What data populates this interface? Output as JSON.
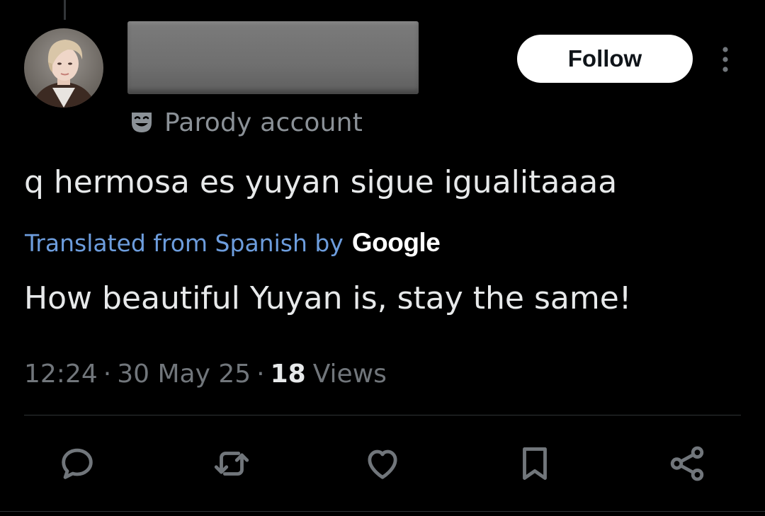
{
  "tweet": {
    "author": {
      "avatar_icon": "profile-photo",
      "label": "Parody account",
      "label_icon": "theater-mask-icon"
    },
    "follow_label": "Follow",
    "more_icon": "more-vertical-icon",
    "text": "q hermosa es yuyan sigue igualitaaaa",
    "translation": {
      "source_label": "Translated from Spanish by",
      "provider": "Google",
      "text": "How beautiful Yuyan is, stay the same!"
    },
    "meta": {
      "time": "12:24",
      "date": "30 May 25",
      "views_count": "18",
      "views_label": "Views",
      "separator": "·"
    },
    "actions": [
      {
        "name": "reply",
        "icon": "reply-icon"
      },
      {
        "name": "repost",
        "icon": "repost-icon"
      },
      {
        "name": "like",
        "icon": "heart-icon"
      },
      {
        "name": "bookmark",
        "icon": "bookmark-icon"
      },
      {
        "name": "share",
        "icon": "share-icon"
      }
    ]
  },
  "colors": {
    "background": "#000000",
    "text_primary": "#e7e9ea",
    "text_secondary": "#71767b",
    "link": "#6d9ddd",
    "follow_bg": "#ffffff",
    "divider": "#2f3336"
  }
}
